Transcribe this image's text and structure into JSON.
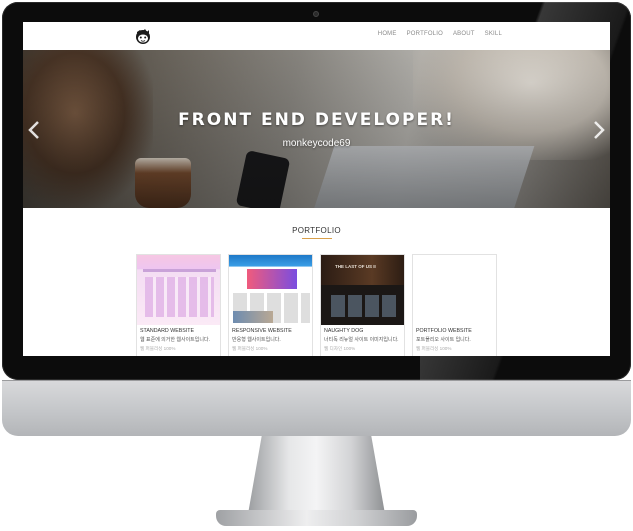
{
  "nav": {
    "items": [
      "HOME",
      "PORTFOLIO",
      "ABOUT",
      "SKILL"
    ]
  },
  "hero": {
    "title": "FRONT END DEVELOPER!",
    "subtitle": "monkeycode69"
  },
  "portfolio": {
    "heading": "PORTFOLIO",
    "cards": [
      {
        "title": "STANDARD WEBSITE",
        "desc": "웹 표준에 의거한 웹사이트입니다.",
        "meta": "웹 퍼블리싱 100%"
      },
      {
        "title": "RESPONSIVE WEBSITE",
        "desc": "반응형 웹사이트입니다.",
        "meta": "웹 퍼블리싱 100%"
      },
      {
        "title": "NAUGHTY DOG",
        "desc": "너티독 리뉴얼 사이트 이미지입니다.",
        "meta": "웹 디자인 100%"
      },
      {
        "title": "PORTFOLIO WEBSITE",
        "desc": "포트폴리오 사이트 입니다.",
        "meta": "웹 퍼블리싱 100%"
      }
    ],
    "thumb3_logo": "THE LAST OF US II"
  },
  "colors": {
    "accent": "#d9a04a",
    "bezel": "#0c0c0c"
  }
}
